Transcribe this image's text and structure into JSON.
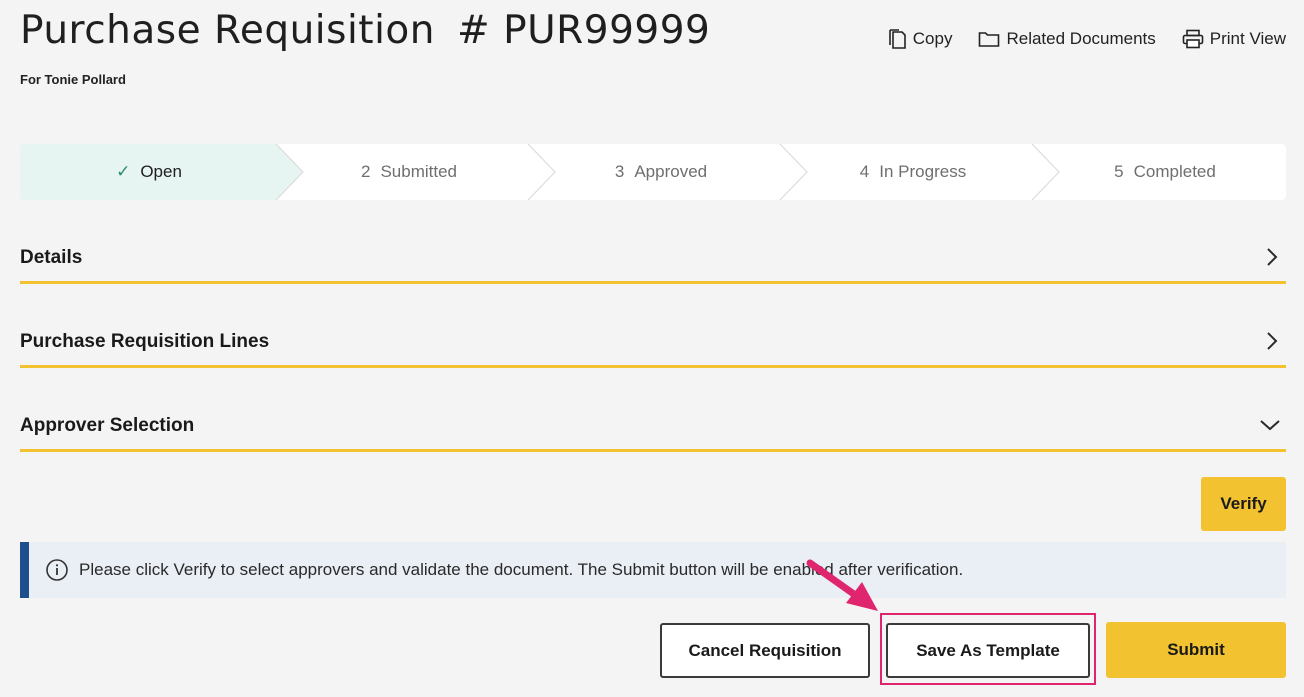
{
  "header": {
    "title": "Purchase Requisition",
    "doc_number": "# PUR99999",
    "subtitle": "For Tonie Pollard",
    "actions": [
      {
        "label": "Copy",
        "icon": "copy-icon"
      },
      {
        "label": "Related Documents",
        "icon": "folder-icon"
      },
      {
        "label": "Print View",
        "icon": "printer-icon"
      }
    ]
  },
  "stepper": {
    "steps": [
      {
        "label": "Open",
        "number": "",
        "active": true
      },
      {
        "label": "Submitted",
        "number": "2",
        "active": false
      },
      {
        "label": "Approved",
        "number": "3",
        "active": false
      },
      {
        "label": "In Progress",
        "number": "4",
        "active": false
      },
      {
        "label": "Completed",
        "number": "5",
        "active": false
      }
    ]
  },
  "sections": [
    {
      "label": "Details",
      "state": "collapsed",
      "icon": "chevron-right-icon"
    },
    {
      "label": "Purchase Requisition Lines",
      "state": "collapsed",
      "icon": "chevron-right-icon"
    },
    {
      "label": "Approver Selection",
      "state": "expanded",
      "icon": "chevron-down-icon"
    }
  ],
  "verify_label": "Verify",
  "info": {
    "message": "Please click Verify to select approvers and validate the document. The Submit button will be enabled after verification.",
    "icon": "info-icon"
  },
  "footer": {
    "cancel_label": "Cancel Requisition",
    "template_label": "Save As Template",
    "submit_label": "Submit"
  },
  "colors": {
    "accent": "#f2c230",
    "active_step": "#e6f4f2",
    "info_border": "#1f4e8c",
    "highlight": "#e0256f"
  }
}
